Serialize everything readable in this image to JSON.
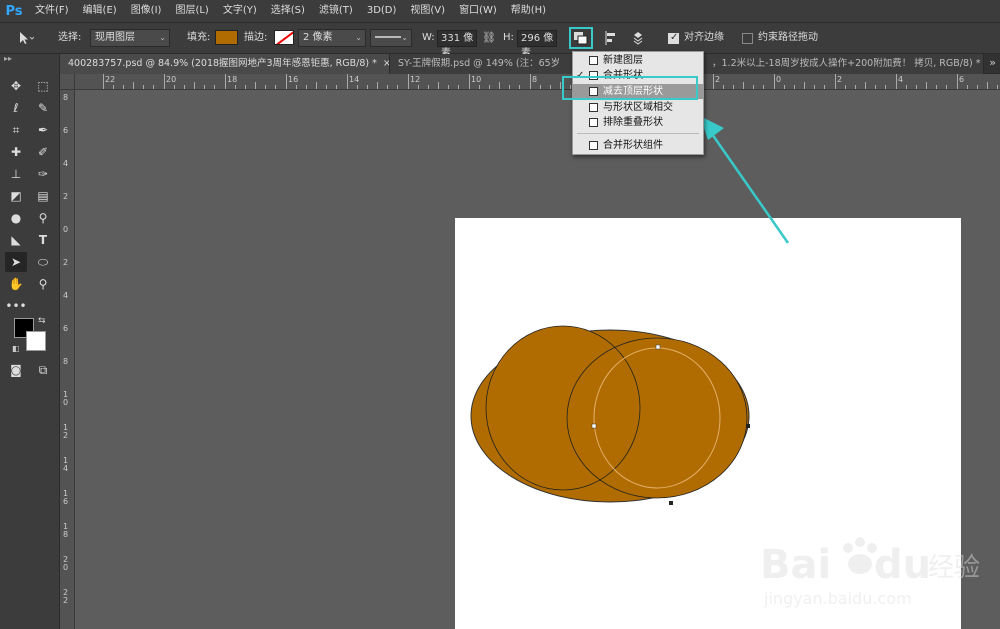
{
  "app": {
    "logo": "Ps"
  },
  "menu": [
    "文件(F)",
    "编辑(E)",
    "图像(I)",
    "图层(L)",
    "文字(Y)",
    "选择(S)",
    "滤镜(T)",
    "3D(D)",
    "视图(V)",
    "窗口(W)",
    "帮助(H)"
  ],
  "options": {
    "select_label": "选择:",
    "select_value": "现用图层",
    "fill_label": "填充:",
    "fill_color": "#b06c00",
    "stroke_label": "描边:",
    "stroke_width": "2 像素",
    "w_label": "W:",
    "w_value": "331 像素",
    "h_label": "H:",
    "h_value": "296 像素",
    "align_edges_label": "对齐边缘",
    "align_edges_checked": true,
    "constrain_label": "约束路径拖动",
    "constrain_checked": false
  },
  "tabs": [
    {
      "label": "400283757.psd @ 84.9% (2018握图网地产3周年感恩钜惠, RGB/8) *",
      "close": "×"
    },
    {
      "label": "SY-王牌假期.psd @ 149% (注：65岁",
      "close": ""
    },
    {
      "label": "，1.2米以上-18周岁按成人操作+200附加费！ 拷贝, RGB/8) *",
      "close": "×"
    }
  ],
  "tab_overflow": "»",
  "hruler_labels": [
    "22",
    "20",
    "18",
    "16",
    "14",
    "12",
    "10",
    "8",
    "6",
    "4",
    "2",
    "0",
    "2",
    "4",
    "6",
    "8"
  ],
  "vruler_labels": [
    "8",
    "6",
    "4",
    "2",
    "0",
    "2",
    "4",
    "6",
    "8",
    "10",
    "12",
    "14",
    "16",
    "18",
    "20",
    "22"
  ],
  "dropdown": {
    "items": [
      {
        "label": "新建图层",
        "checked": false,
        "selected": false
      },
      {
        "label": "合并形状",
        "checked": true,
        "selected": false
      },
      {
        "label": "减去顶层形状",
        "checked": false,
        "selected": true
      },
      {
        "label": "与形状区域相交",
        "checked": false,
        "selected": false
      },
      {
        "label": "排除重叠形状",
        "checked": false,
        "selected": false
      }
    ],
    "footer_item": "合并形状组件"
  },
  "shape_color": "#b06c00",
  "highlight_color": "#3ac9c9",
  "watermark": {
    "brand": "Bai",
    "brand2": "du",
    "cn": "经验",
    "url": "jingyan.baidu.com"
  }
}
